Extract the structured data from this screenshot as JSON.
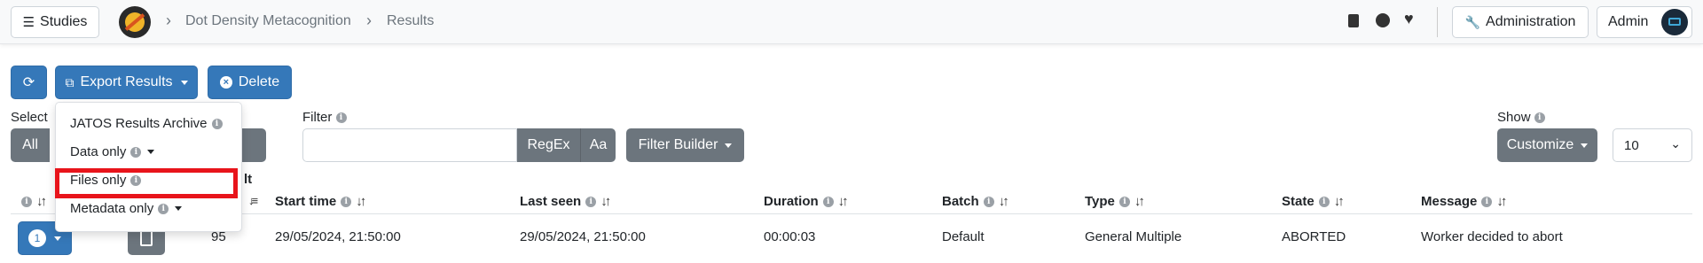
{
  "nav": {
    "studies_label": "Studies",
    "breadcrumb": [
      "Dot Density Metacognition",
      "Results"
    ],
    "admin_button_label": "Administration",
    "user_label": "Admin"
  },
  "toolbar": {
    "export_label": "Export Results",
    "delete_label": "Delete"
  },
  "export_menu": {
    "items": [
      "JATOS Results Archive",
      "Data only",
      "Files only",
      "Metadata only"
    ]
  },
  "select": {
    "label": "Select",
    "all_label": "All",
    "partial_label": "ct"
  },
  "filter": {
    "label": "Filter",
    "value": "",
    "regex_label": "RegEx",
    "case_label": "Aa",
    "builder_label": "Filter Builder"
  },
  "show": {
    "label": "Show",
    "customize_label": "Customize",
    "page_size": "10"
  },
  "table": {
    "partial_header": "lt",
    "columns": [
      "Start time",
      "Last seen",
      "Duration",
      "Batch",
      "Type",
      "State",
      "Message"
    ],
    "rows": [
      {
        "badge": "1",
        "id": "95",
        "start_time": "29/05/2024, 21:50:00",
        "last_seen": "29/05/2024, 21:50:00",
        "duration": "00:00:03",
        "batch": "Default",
        "type": "General Multiple",
        "state": "ABORTED",
        "message": "Worker decided to abort"
      }
    ]
  },
  "colors": {
    "primary": "#3578b9",
    "secondary": "#6c757d",
    "highlight": "#e8141b"
  }
}
